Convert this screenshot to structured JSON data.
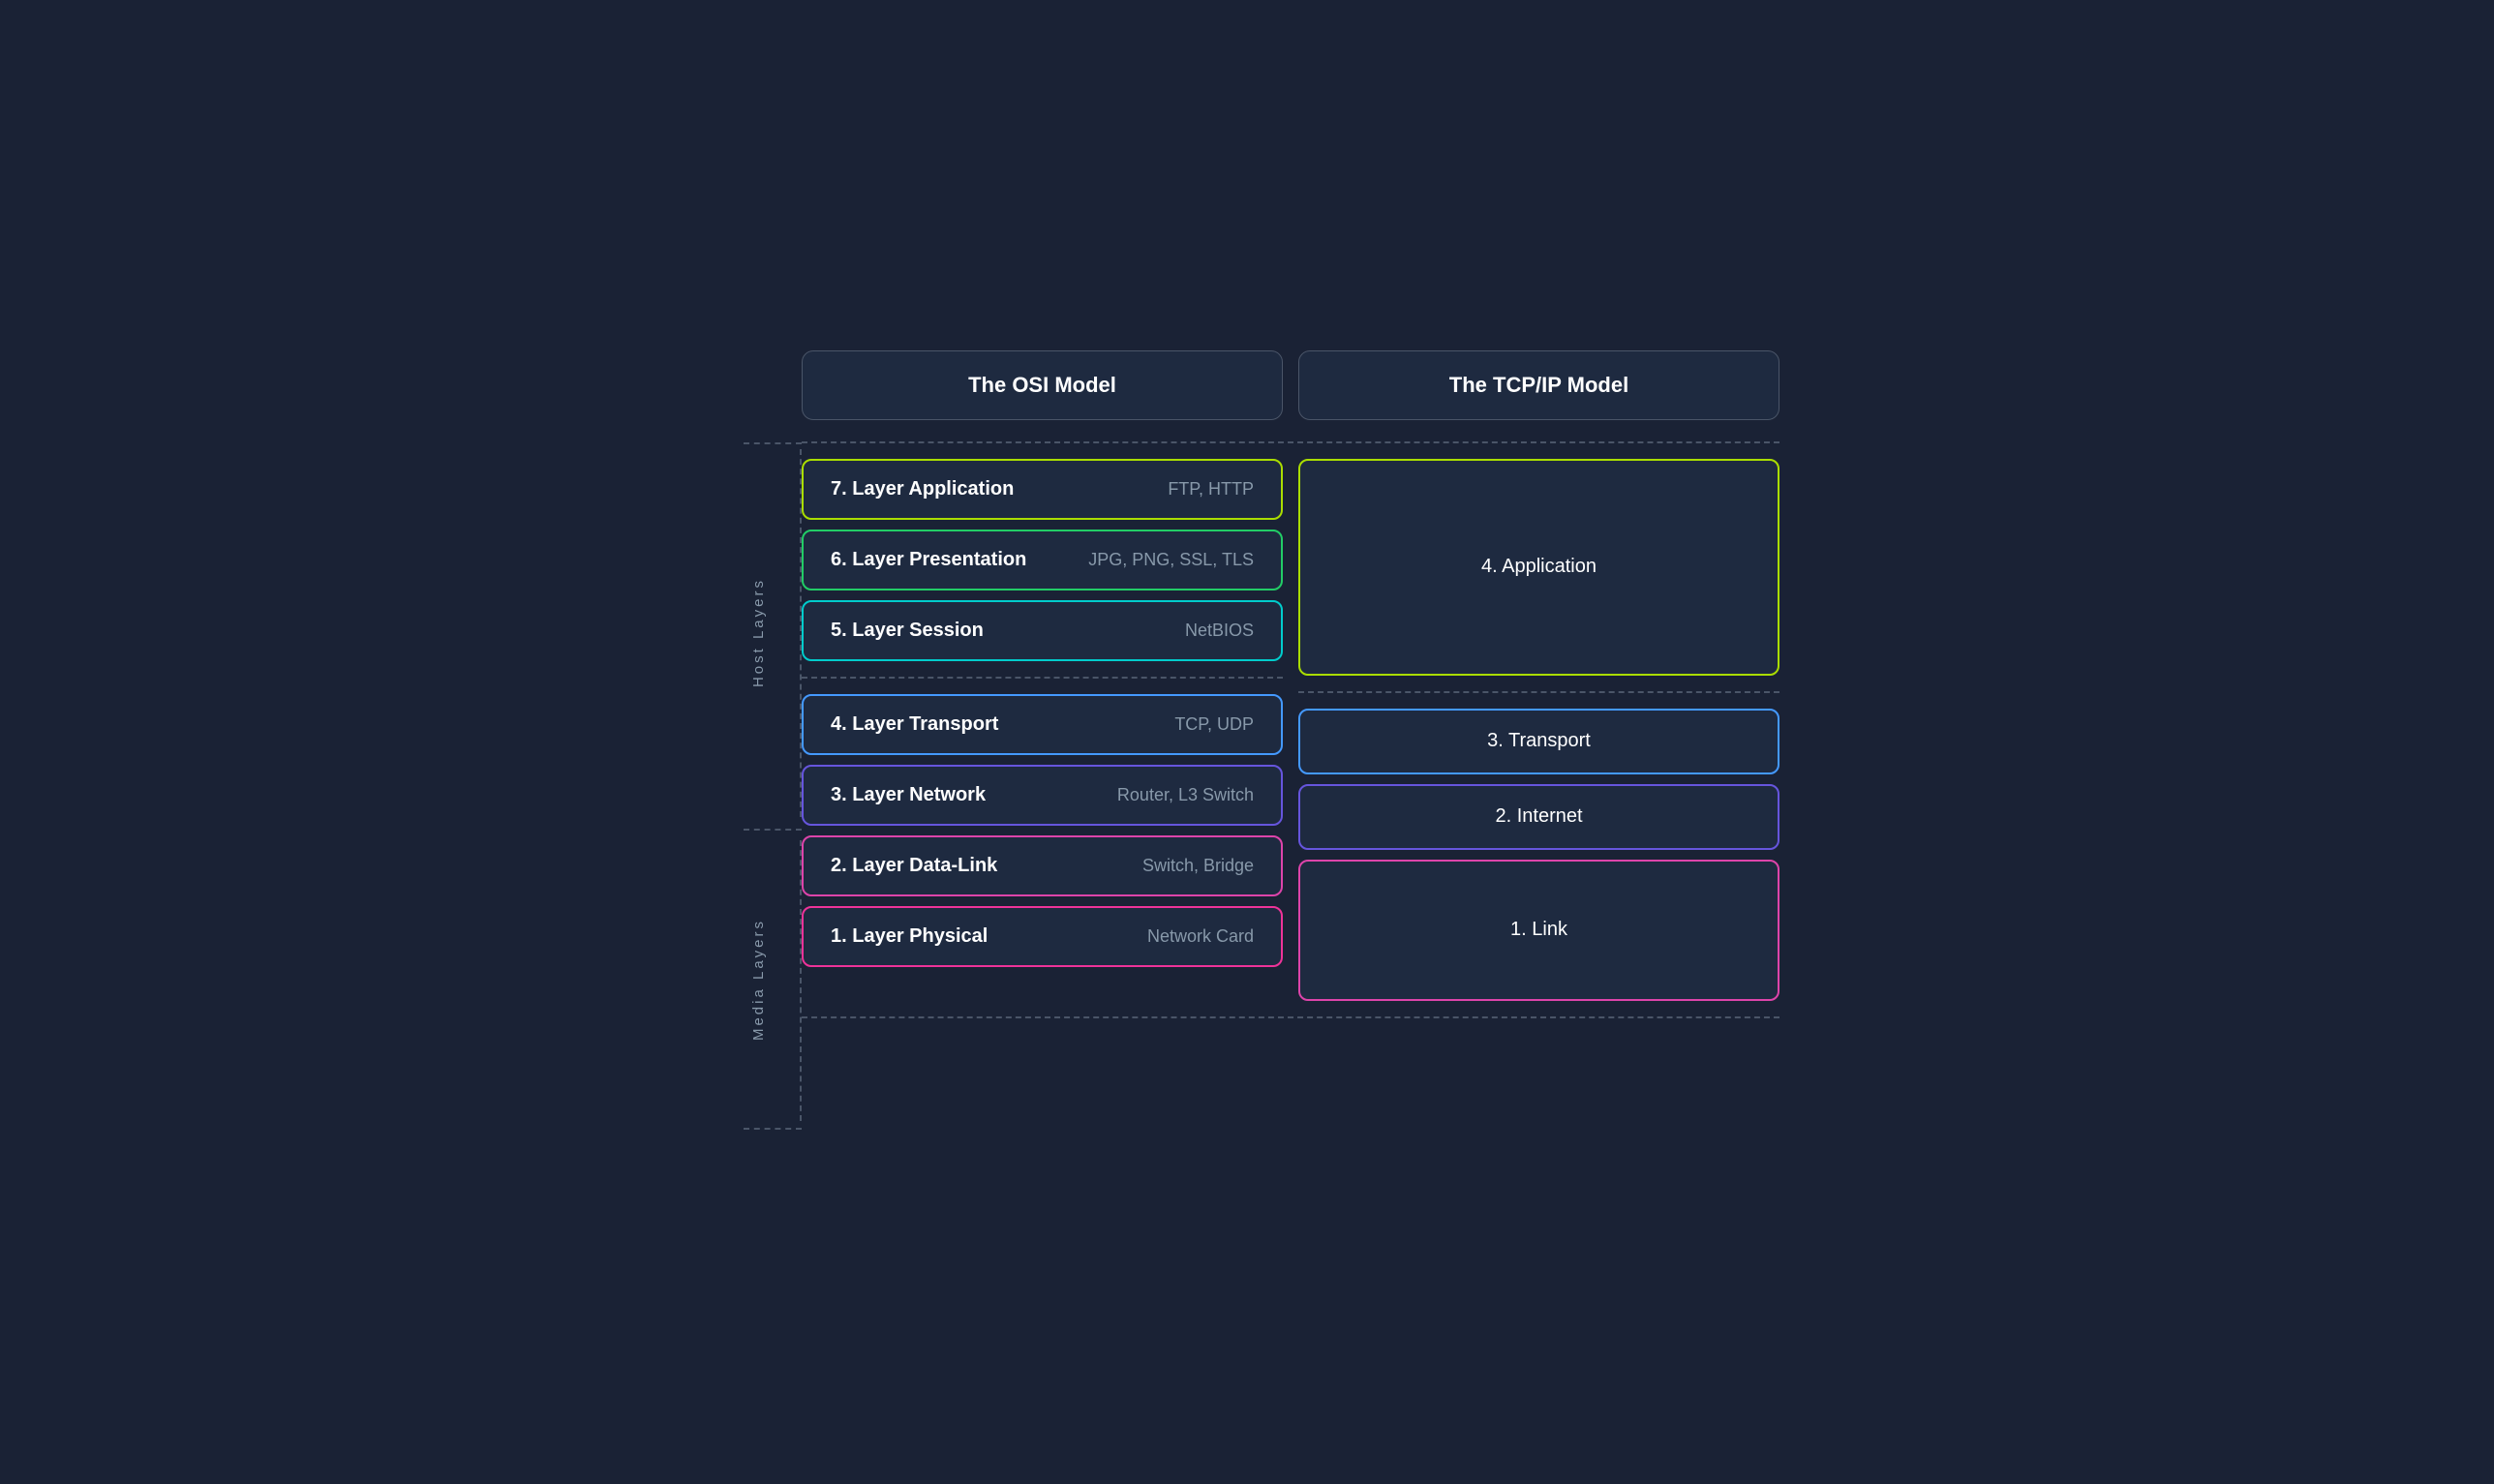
{
  "headers": {
    "osi_title": "The OSI Model",
    "tcp_title": "The TCP/IP Model"
  },
  "labels": {
    "host_layers": "Host Layers",
    "media_layers": "Media Layers"
  },
  "osi_layers": [
    {
      "number": 7,
      "name": "7. Layer Application",
      "protocol": "FTP, HTTP",
      "border_color": "#aadd00"
    },
    {
      "number": 6,
      "name": "6. Layer Presentation",
      "protocol": "JPG, PNG, SSL, TLS",
      "border_color": "#55cc44"
    },
    {
      "number": 5,
      "name": "5. Layer Session",
      "protocol": "NetBIOS",
      "border_color": "#00cccc"
    },
    {
      "number": 4,
      "name": "4. Layer Transport",
      "protocol": "TCP, UDP",
      "border_color": "#4499ff"
    },
    {
      "number": 3,
      "name": "3. Layer Network",
      "protocol": "Router, L3 Switch",
      "border_color": "#6655dd"
    },
    {
      "number": 2,
      "name": "2. Layer Data-Link",
      "protocol": "Switch, Bridge",
      "border_color": "#cc44aa"
    },
    {
      "number": 1,
      "name": "1. Layer Physical",
      "protocol": "Network Card",
      "border_color": "#ee3399"
    }
  ],
  "tcp_layers": [
    {
      "number": 4,
      "name": "4. Application",
      "spans": 3,
      "border_color": "#aadd00"
    },
    {
      "number": 3,
      "name": "3. Transport",
      "spans": 1,
      "border_color": "#4499ff"
    },
    {
      "number": 2,
      "name": "2. Internet",
      "spans": 1,
      "border_color": "#6655dd"
    },
    {
      "number": 1,
      "name": "1. Link",
      "spans": 2,
      "border_color": "#ee3399"
    }
  ]
}
